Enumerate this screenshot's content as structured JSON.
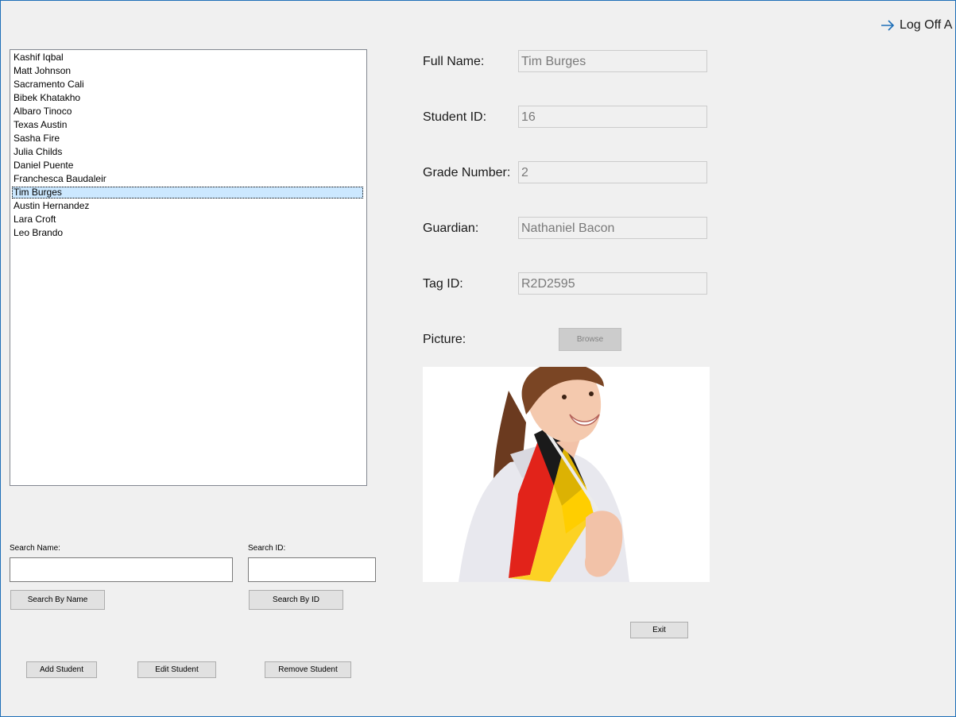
{
  "header": {
    "logoff_label": "Log Off A"
  },
  "students": {
    "items": [
      {
        "name": "Kashif Iqbal"
      },
      {
        "name": "Matt Johnson"
      },
      {
        "name": "Sacramento Cali"
      },
      {
        "name": "Bibek Khatakho"
      },
      {
        "name": "Albaro Tinoco"
      },
      {
        "name": "Texas Austin"
      },
      {
        "name": "Sasha Fire"
      },
      {
        "name": "Julia Childs"
      },
      {
        "name": "Daniel Puente"
      },
      {
        "name": "Franchesca Baudaleir"
      },
      {
        "name": "Tim Burges",
        "selected": true
      },
      {
        "name": "Austin Hernandez"
      },
      {
        "name": "Lara Croft"
      },
      {
        "name": "Leo Brando"
      }
    ]
  },
  "details": {
    "full_name_label": "Full Name:",
    "full_name_value": "Tim Burges",
    "student_id_label": "Student ID:",
    "student_id_value": "16",
    "grade_label": "Grade Number:",
    "grade_value": "2",
    "guardian_label": "Guardian:",
    "guardian_value": "Nathaniel Bacon",
    "tag_label": "Tag ID:",
    "tag_value": "R2D2595",
    "picture_label": "Picture:",
    "browse_label": "Browse"
  },
  "search": {
    "name_label": "Search Name:",
    "name_value": "",
    "id_label": "Search ID:",
    "id_value": "",
    "by_name_label": "Search By Name",
    "by_id_label": "Search By ID"
  },
  "actions": {
    "add_label": "Add Student",
    "edit_label": "Edit Student",
    "remove_label": "Remove Student",
    "exit_label": "Exit"
  },
  "colors": {
    "accent": "#1e6fb8",
    "selection": "#cce8ff"
  }
}
